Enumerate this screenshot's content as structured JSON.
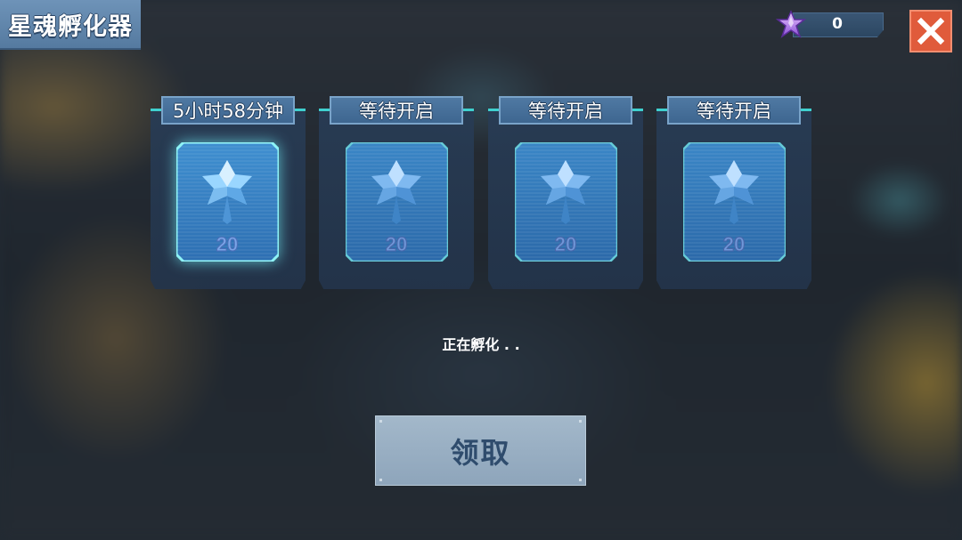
{
  "header": {
    "title": "星魂孵化器",
    "close_icon": "close-icon"
  },
  "currency": {
    "icon": "purple-star-crystal-icon",
    "value": "0"
  },
  "slots": [
    {
      "label": "5小时58分钟",
      "count": "20",
      "state": "incubating"
    },
    {
      "label": "等待开启",
      "count": "20",
      "state": "waiting"
    },
    {
      "label": "等待开启",
      "count": "20",
      "state": "waiting"
    },
    {
      "label": "等待开启",
      "count": "20",
      "state": "waiting"
    }
  ],
  "status_text": "正在孵化 . .",
  "claim_button": {
    "label": "领取"
  },
  "colors": {
    "accent_cyan": "#3fd0cf",
    "close_red": "#e05b3b",
    "panel_blue": "#4f79a3"
  }
}
